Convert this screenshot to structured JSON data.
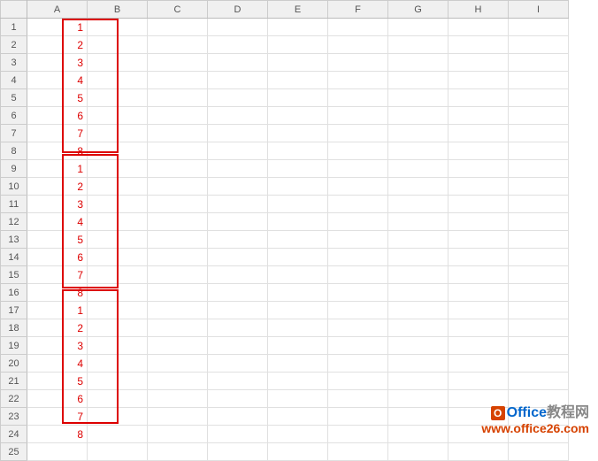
{
  "columns": [
    "A",
    "B",
    "C",
    "D",
    "E",
    "F",
    "G",
    "H",
    "I"
  ],
  "rows": [
    "1",
    "2",
    "3",
    "4",
    "5",
    "6",
    "7",
    "8",
    "9",
    "10",
    "11",
    "12",
    "13",
    "14",
    "15",
    "16",
    "17",
    "18",
    "19",
    "20",
    "21",
    "22",
    "23",
    "24",
    "25"
  ],
  "cells": {
    "A": [
      "1",
      "2",
      "3",
      "4",
      "5",
      "6",
      "7",
      "8",
      "1",
      "2",
      "3",
      "4",
      "5",
      "6",
      "7",
      "8",
      "1",
      "2",
      "3",
      "4",
      "5",
      "6",
      "7",
      "8",
      ""
    ]
  },
  "watermark": {
    "brand_prefix": "Office",
    "brand_suffix": "教程网",
    "url": "www.office26.com"
  }
}
